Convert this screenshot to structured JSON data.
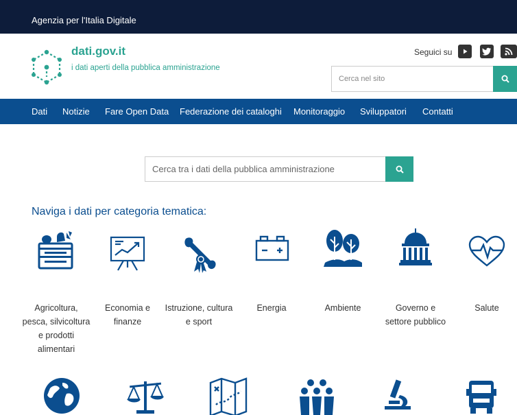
{
  "topbar": {
    "agency": "Agenzia per l'Italia Digitale"
  },
  "header": {
    "logo_title": "dati.gov.it",
    "logo_subtitle": "i dati aperti della pubblica amministrazione",
    "follow_label": "Seguici su",
    "social": [
      "youtube-icon",
      "twitter-icon",
      "rss-icon"
    ],
    "search_placeholder": "Cerca nel sito"
  },
  "nav": {
    "items": [
      "Dati",
      "Notizie",
      "Fare Open Data",
      "Federazione dei cataloghi",
      "Monitoraggio",
      "Sviluppatori",
      "Contatti"
    ]
  },
  "main": {
    "search_placeholder": "Cerca tra i dati della pubblica amministrazione",
    "section_title": "Naviga i dati per categoria tematica:",
    "categories": [
      {
        "label": "Agricoltura, pesca, silvicoltura e prodotti alimentari",
        "icon": "crate-vegetables-icon"
      },
      {
        "label": "Economia e finanze",
        "icon": "chart-board-icon"
      },
      {
        "label": "Istruzione, cultura e sport",
        "icon": "diploma-icon"
      },
      {
        "label": "Energia",
        "icon": "battery-icon"
      },
      {
        "label": "Ambiente",
        "icon": "trees-icon"
      },
      {
        "label": "Governo e settore pubblico",
        "icon": "government-building-icon"
      },
      {
        "label": "Salute",
        "icon": "heartbeat-icon"
      }
    ],
    "row2_icons": [
      "globe-icon",
      "scales-icon",
      "map-icon",
      "people-icon",
      "microscope-icon",
      "truck-icon"
    ]
  },
  "colors": {
    "topbar": "#0d1c3a",
    "nav": "#0b4e8f",
    "accent": "#2ba391",
    "icon": "#0b4e8f"
  }
}
